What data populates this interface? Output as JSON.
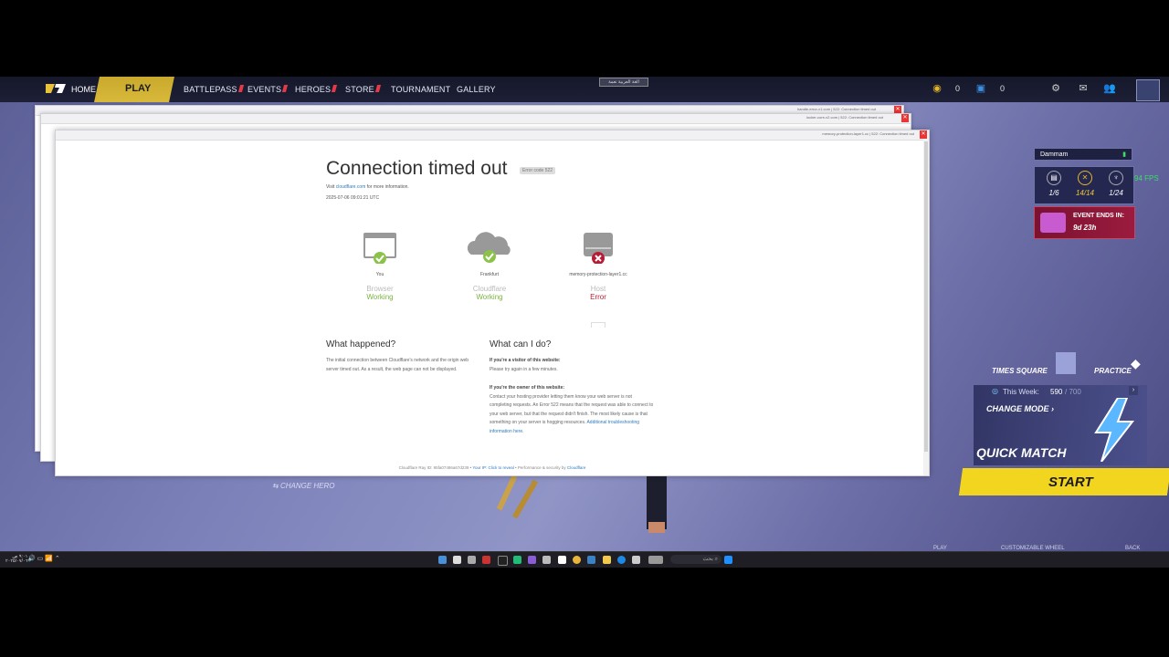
{
  "game": {
    "nav": {
      "home": "HOME",
      "play": "PLAY",
      "battlepass": "BATTLEPASS",
      "events": "EVENTS",
      "heroes": "HEROES",
      "store": "STORE",
      "tournament": "TOURNAMENT",
      "gallery": "GALLERY"
    },
    "center_banner": "الغة العربية نعمة",
    "currency_gold": "0",
    "currency_blue": "0",
    "region": "Dammam",
    "stats": [
      "1/6",
      "14/14",
      "1/24"
    ],
    "fps": "94 FPS",
    "event_title": "EVENT ENDS IN:",
    "event_time": "9d 23h",
    "mode_times_square": "TIMES SQUARE",
    "mode_practice": "PRACTICE",
    "this_week_label": "This Week:",
    "this_week_value": "590",
    "this_week_total": "/ 700",
    "change_mode": "CHANGE MODE",
    "quick_match": "QUICK MATCH",
    "start": "START",
    "change_hero": "CHANGE HERO",
    "bottom_play": "PLAY",
    "bottom_wheel": "CUSTOMIZABLE WHEEL",
    "bottom_back": "BACK"
  },
  "windows": {
    "back_title_1": "handle-error-v1.com | 522: Connection timed out",
    "back_title_2": "locker-core-v2.com | 522: Connection timed out",
    "main_title": "memory-protection-layer1.cc | 522: Connection timed out"
  },
  "cloudflare": {
    "title": "Connection timed out",
    "error_code": "Error code 522",
    "visit_prefix": "Visit",
    "visit_link": "cloudflare.com",
    "visit_suffix": "for more information.",
    "timestamp": "2025-07-06 09:01:21 UTC",
    "nodes": [
      {
        "place": "You",
        "role": "Browser",
        "status": "Working",
        "ok": true
      },
      {
        "place": "Frankfurt",
        "role": "Cloudflare",
        "status": "Working",
        "ok": true
      },
      {
        "place": "memory-protection-layer1.cc",
        "role": "Host",
        "status": "Error",
        "ok": false
      }
    ],
    "what_happened_title": "What happened?",
    "what_happened_text": "The initial connection between Cloudflare's network and the origin web server timed out. As a result, the web page can not be displayed.",
    "what_do_title": "What can I do?",
    "visitor_heading": "If you're a visitor of this website:",
    "visitor_text": "Please try again in a few minutes.",
    "owner_heading": "If you're the owner of this website:",
    "owner_text": "Contact your hosting provider letting them know your web server is not completing requests. An Error 522 means that the request was able to connect to your web server, but that the request didn't finish. The most likely cause is that something on your server is hogging resources.",
    "owner_link": "Additional troubleshooting information here.",
    "footer_ray": "Cloudflare Ray ID: 95fa07486a67d239",
    "footer_ip": "Your IP: Click to reveal",
    "footer_perf": "Performance & security by",
    "footer_cf": "Cloudflare"
  },
  "taskbar": {
    "search_text": "بحث",
    "time": "٩:٠١ ص",
    "date": "٢٠٢٥/٠٧/٠٦"
  },
  "colors": {
    "working": "#7cb342",
    "error": "#b71c36",
    "start_yellow": "#f2d51f",
    "fps_green": "#3ddc6a"
  }
}
